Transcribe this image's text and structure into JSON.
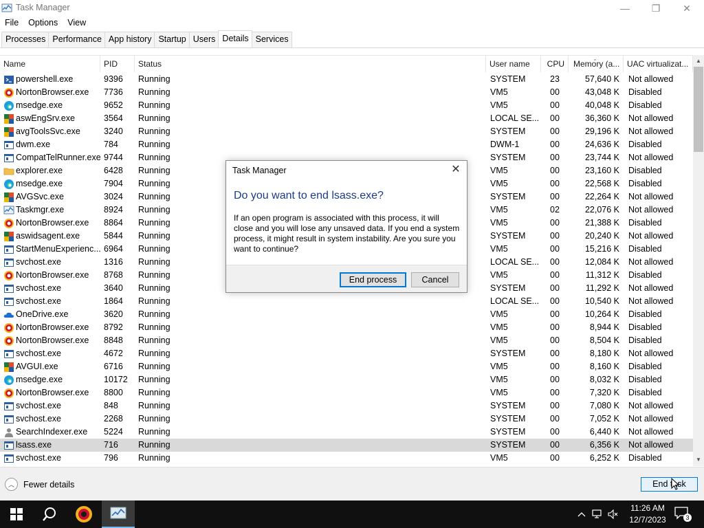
{
  "window": {
    "title": "Task Manager",
    "controls": {
      "minimize": "—",
      "maximize": "❐",
      "close": "✕"
    }
  },
  "menu": [
    "File",
    "Options",
    "View"
  ],
  "tabs": [
    "Processes",
    "Performance",
    "App history",
    "Startup",
    "Users",
    "Details",
    "Services"
  ],
  "active_tab": "Details",
  "columns": {
    "name": "Name",
    "pid": "PID",
    "status": "Status",
    "user": "User name",
    "cpu": "CPU",
    "memory": "Memory (a...",
    "uac": "UAC virtualizat..."
  },
  "processes": [
    {
      "icon": "powershell",
      "name": "powershell.exe",
      "pid": "9396",
      "status": "Running",
      "user": "SYSTEM",
      "cpu": "23",
      "memory": "57,640 K",
      "uac": "Not allowed"
    },
    {
      "icon": "norton",
      "name": "NortonBrowser.exe",
      "pid": "7736",
      "status": "Running",
      "user": "VM5",
      "cpu": "00",
      "memory": "43,048 K",
      "uac": "Disabled"
    },
    {
      "icon": "edge",
      "name": "msedge.exe",
      "pid": "9652",
      "status": "Running",
      "user": "VM5",
      "cpu": "00",
      "memory": "40,048 K",
      "uac": "Disabled"
    },
    {
      "icon": "avg",
      "name": "aswEngSrv.exe",
      "pid": "3564",
      "status": "Running",
      "user": "LOCAL SE...",
      "cpu": "00",
      "memory": "36,360 K",
      "uac": "Not allowed"
    },
    {
      "icon": "avg",
      "name": "avgToolsSvc.exe",
      "pid": "3240",
      "status": "Running",
      "user": "SYSTEM",
      "cpu": "00",
      "memory": "29,196 K",
      "uac": "Not allowed"
    },
    {
      "icon": "window",
      "name": "dwm.exe",
      "pid": "784",
      "status": "Running",
      "user": "DWM-1",
      "cpu": "00",
      "memory": "24,636 K",
      "uac": "Disabled"
    },
    {
      "icon": "window",
      "name": "CompatTelRunner.exe",
      "pid": "9744",
      "status": "Running",
      "user": "SYSTEM",
      "cpu": "00",
      "memory": "23,744 K",
      "uac": "Not allowed"
    },
    {
      "icon": "explorer",
      "name": "explorer.exe",
      "pid": "6428",
      "status": "Running",
      "user": "VM5",
      "cpu": "00",
      "memory": "23,160 K",
      "uac": "Disabled"
    },
    {
      "icon": "edge",
      "name": "msedge.exe",
      "pid": "7904",
      "status": "Running",
      "user": "VM5",
      "cpu": "00",
      "memory": "22,568 K",
      "uac": "Disabled"
    },
    {
      "icon": "avg",
      "name": "AVGSvc.exe",
      "pid": "3024",
      "status": "Running",
      "user": "SYSTEM",
      "cpu": "00",
      "memory": "22,264 K",
      "uac": "Not allowed"
    },
    {
      "icon": "taskmgr",
      "name": "Taskmgr.exe",
      "pid": "8924",
      "status": "Running",
      "user": "VM5",
      "cpu": "02",
      "memory": "22,076 K",
      "uac": "Not allowed"
    },
    {
      "icon": "norton",
      "name": "NortonBrowser.exe",
      "pid": "8864",
      "status": "Running",
      "user": "VM5",
      "cpu": "00",
      "memory": "21,388 K",
      "uac": "Disabled"
    },
    {
      "icon": "avg",
      "name": "aswidsagent.exe",
      "pid": "5844",
      "status": "Running",
      "user": "SYSTEM",
      "cpu": "00",
      "memory": "20,240 K",
      "uac": "Not allowed"
    },
    {
      "icon": "window",
      "name": "StartMenuExperienc...",
      "pid": "6964",
      "status": "Running",
      "user": "VM5",
      "cpu": "00",
      "memory": "15,216 K",
      "uac": "Disabled"
    },
    {
      "icon": "window",
      "name": "svchost.exe",
      "pid": "1316",
      "status": "Running",
      "user": "LOCAL SE...",
      "cpu": "00",
      "memory": "12,084 K",
      "uac": "Not allowed"
    },
    {
      "icon": "norton",
      "name": "NortonBrowser.exe",
      "pid": "8768",
      "status": "Running",
      "user": "VM5",
      "cpu": "00",
      "memory": "11,312 K",
      "uac": "Disabled"
    },
    {
      "icon": "window",
      "name": "svchost.exe",
      "pid": "3640",
      "status": "Running",
      "user": "SYSTEM",
      "cpu": "00",
      "memory": "11,292 K",
      "uac": "Not allowed"
    },
    {
      "icon": "window",
      "name": "svchost.exe",
      "pid": "1864",
      "status": "Running",
      "user": "LOCAL SE...",
      "cpu": "00",
      "memory": "10,540 K",
      "uac": "Not allowed"
    },
    {
      "icon": "onedrive",
      "name": "OneDrive.exe",
      "pid": "3620",
      "status": "Running",
      "user": "VM5",
      "cpu": "00",
      "memory": "10,264 K",
      "uac": "Disabled"
    },
    {
      "icon": "norton",
      "name": "NortonBrowser.exe",
      "pid": "8792",
      "status": "Running",
      "user": "VM5",
      "cpu": "00",
      "memory": "8,944 K",
      "uac": "Disabled"
    },
    {
      "icon": "norton",
      "name": "NortonBrowser.exe",
      "pid": "8848",
      "status": "Running",
      "user": "VM5",
      "cpu": "00",
      "memory": "8,504 K",
      "uac": "Disabled"
    },
    {
      "icon": "window",
      "name": "svchost.exe",
      "pid": "4672",
      "status": "Running",
      "user": "SYSTEM",
      "cpu": "00",
      "memory": "8,180 K",
      "uac": "Not allowed"
    },
    {
      "icon": "avg",
      "name": "AVGUI.exe",
      "pid": "6716",
      "status": "Running",
      "user": "VM5",
      "cpu": "00",
      "memory": "8,160 K",
      "uac": "Disabled"
    },
    {
      "icon": "edge",
      "name": "msedge.exe",
      "pid": "10172",
      "status": "Running",
      "user": "VM5",
      "cpu": "00",
      "memory": "8,032 K",
      "uac": "Disabled"
    },
    {
      "icon": "norton",
      "name": "NortonBrowser.exe",
      "pid": "8800",
      "status": "Running",
      "user": "VM5",
      "cpu": "00",
      "memory": "7,320 K",
      "uac": "Disabled"
    },
    {
      "icon": "window",
      "name": "svchost.exe",
      "pid": "848",
      "status": "Running",
      "user": "SYSTEM",
      "cpu": "00",
      "memory": "7,080 K",
      "uac": "Not allowed"
    },
    {
      "icon": "window",
      "name": "svchost.exe",
      "pid": "2268",
      "status": "Running",
      "user": "SYSTEM",
      "cpu": "00",
      "memory": "7,052 K",
      "uac": "Not allowed"
    },
    {
      "icon": "search",
      "name": "SearchIndexer.exe",
      "pid": "5224",
      "status": "Running",
      "user": "SYSTEM",
      "cpu": "00",
      "memory": "6,440 K",
      "uac": "Not allowed"
    },
    {
      "icon": "window",
      "name": "lsass.exe",
      "pid": "716",
      "status": "Running",
      "user": "SYSTEM",
      "cpu": "00",
      "memory": "6,356 K",
      "uac": "Not allowed",
      "selected": true
    },
    {
      "icon": "window",
      "name": "svchost.exe",
      "pid": "796",
      "status": "Running",
      "user": "VM5",
      "cpu": "00",
      "memory": "6,252 K",
      "uac": "Disabled"
    }
  ],
  "footer": {
    "fewer_details": "Fewer details",
    "end_task": "End task"
  },
  "dialog": {
    "title": "Task Manager",
    "heading": "Do you want to end lsass.exe?",
    "body": "If an open program is associated with this process, it will close and you will lose any unsaved data. If you end a system process, it might result in system instability. Are you sure you want to continue?",
    "end_process": "End process",
    "cancel": "Cancel"
  },
  "taskbar": {
    "time": "11:26 AM",
    "date": "12/7/2023",
    "notification_count": "3"
  },
  "colors": {
    "accent": "#0078d7",
    "dialog_heading": "#1a3a8c",
    "selected_row": "#d9d9d9",
    "taskbar": "#101010"
  }
}
